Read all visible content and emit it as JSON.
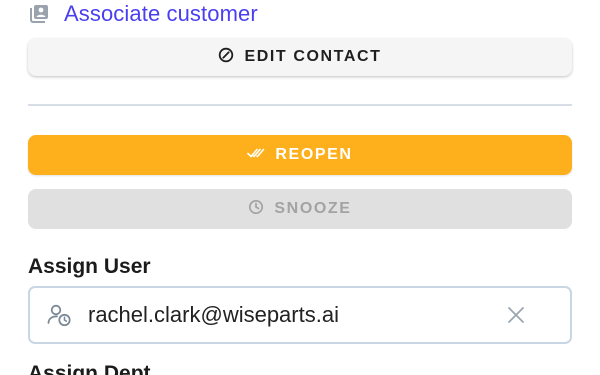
{
  "associate": {
    "label": "Associate customer",
    "icon": "contact-book-icon"
  },
  "buttons": {
    "edit_contact": {
      "label": "EDIT CONTACT",
      "icon": "edit-circle-icon"
    },
    "reopen": {
      "label": "REOPEN",
      "icon": "double-check-icon",
      "color": "#fdb01c"
    },
    "snooze": {
      "label": "SNOOZE",
      "icon": "clock-icon",
      "disabled": true
    }
  },
  "assign_user": {
    "title": "Assign User",
    "value": "rachel.clark@wiseparts.ai",
    "icon": "user-clock-icon",
    "clear_icon": "close-icon"
  },
  "next_section": {
    "title": "Assign Dept"
  },
  "colors": {
    "accent": "#4a3ff0",
    "reopen": "#fdb01c",
    "disabled": "#e0e0e0",
    "border": "#c9d6e4"
  }
}
